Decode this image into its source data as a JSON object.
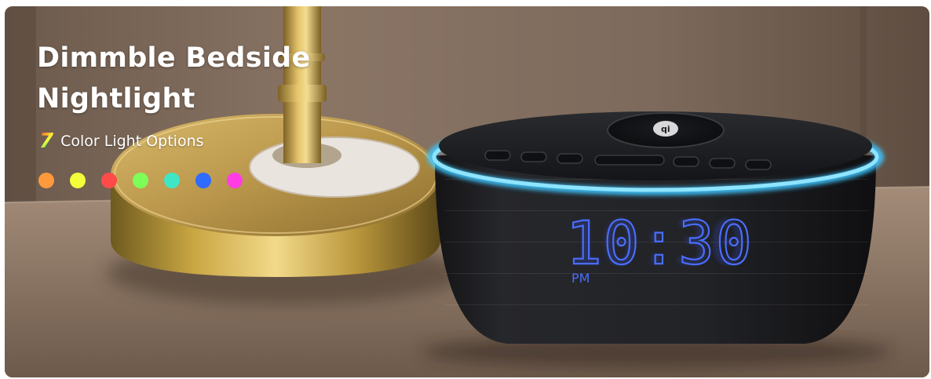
{
  "banner": {
    "title": "Dimmble Bedside Nightlight",
    "subtitle_number": "7",
    "subtitle_text": "Color Light Options",
    "color_dots": [
      "#ff9a3c",
      "#f4ff3a",
      "#ff4a4a",
      "#7dff58",
      "#3fe6c6",
      "#2f6bff",
      "#ff3de4"
    ]
  },
  "device": {
    "time": "10:30",
    "period": "PM",
    "accent_color": "#3ec6ff",
    "display_color": "#3a5bff"
  }
}
